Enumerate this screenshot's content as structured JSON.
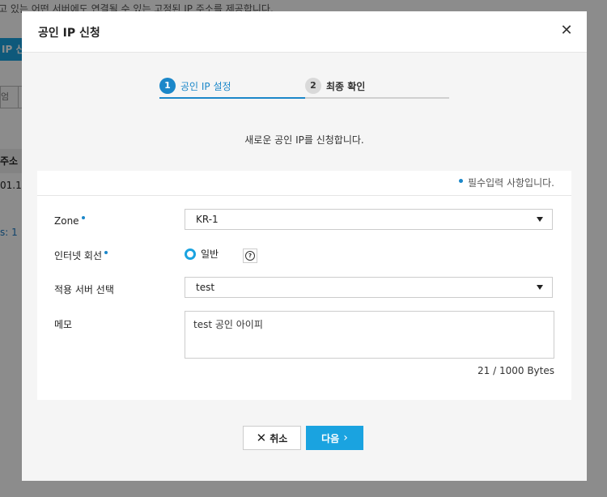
{
  "background": {
    "description_text": "고 있는 어떤 서버에도 연결될 수 있는 고정된 IP 주소를 제공합니다.",
    "button_label": "IP 신",
    "filter_label": "엄",
    "table_header": "주소",
    "table_cell": "01.101",
    "count_text": "s: 1"
  },
  "modal": {
    "title": "공인 IP 신청",
    "steps": [
      {
        "number": "1",
        "label": "공인 IP 설정",
        "active": true
      },
      {
        "number": "2",
        "label": "최종 확인",
        "active": false
      }
    ],
    "intro": "새로운 공인 IP를 신청합니다.",
    "required_note": "필수입력 사항입니다.",
    "form": {
      "zone": {
        "label": "Zone",
        "value": "KR-1",
        "required": true
      },
      "internet_line": {
        "label": "인터넷 회선",
        "value": "일반",
        "required": true
      },
      "server": {
        "label": "적용 서버 선택",
        "value": "test",
        "required": false
      },
      "memo": {
        "label": "메모",
        "value": "test 공인 아이피",
        "byte_count": "21 / 1000 Bytes"
      }
    },
    "buttons": {
      "cancel": "취소",
      "next": "다음"
    }
  },
  "colors": {
    "accent": "#1b87c9",
    "primary_button": "#1aa3e0"
  }
}
